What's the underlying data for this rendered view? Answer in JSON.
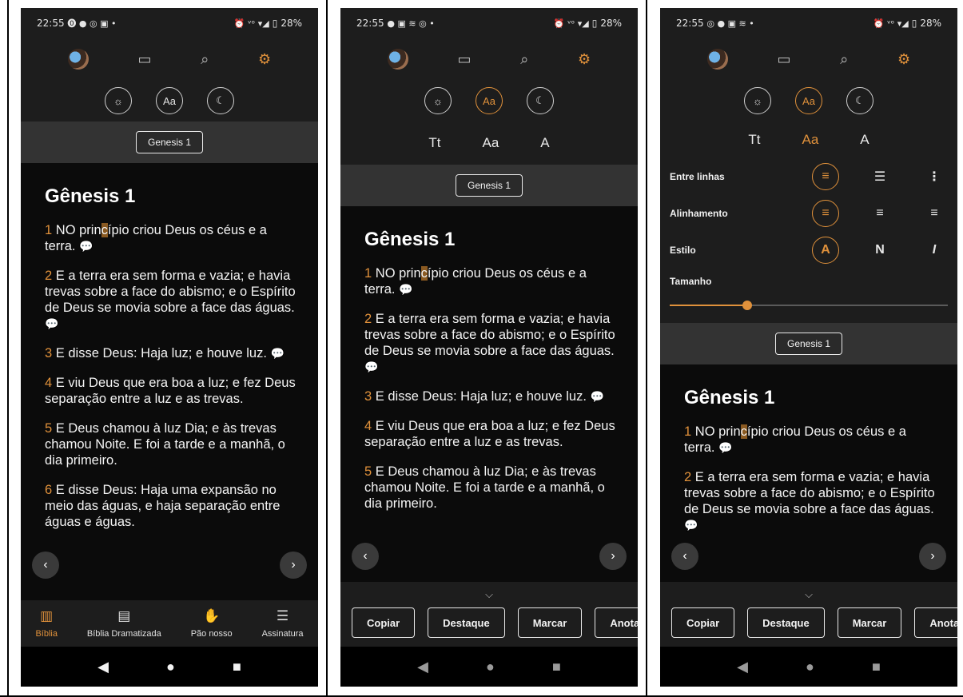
{
  "status": {
    "time": "22:55",
    "battery": "28%",
    "left_icons_1": "⓿ ● ◎ ▣ •",
    "left_icons_2": "● ▣ ≋ ◎ •",
    "left_icons_3": "◎ ● ▣ ≋ •",
    "right_icons": "⏰ ᵛᵒ ▾◢"
  },
  "topnav_icons": [
    "avatar",
    "book-icon",
    "search-icon",
    "gear-icon"
  ],
  "modes": {
    "brightness": "☼",
    "font": "Aa",
    "theme": "☾"
  },
  "typography_tabs": {
    "tt": "Tt",
    "aa": "Aa",
    "a": "A"
  },
  "settings": {
    "line_spacing_label": "Entre linhas",
    "alignment_label": "Alinhamento",
    "style_label": "Estilo",
    "size_label": "Tamanho",
    "style_options": [
      "A",
      "N",
      "I"
    ],
    "size_fraction": 0.28
  },
  "chapter_button": "Genesis 1",
  "reader": {
    "title": "Gênesis 1",
    "verses": [
      {
        "num": "1",
        "pre": "NO prin",
        "hl": "c",
        "post": "ípio criou Deus os céus e a terra."
      },
      {
        "num": "2",
        "text": "E a terra era sem forma e vazia; e havia trevas sobre a face do abismo; e o Espírito de Deus se movia sobre a face das águas."
      },
      {
        "num": "3",
        "text": "E disse Deus: Haja luz; e houve luz."
      },
      {
        "num": "4",
        "text": "E viu Deus que era boa a luz; e fez Deus separação entre a luz e as trevas."
      },
      {
        "num": "5",
        "text": "E Deus chamou à luz Dia; e às trevas chamou Noite. E foi a tarde e a manhã, o dia primeiro."
      },
      {
        "num": "6",
        "text": "E disse Deus: Haja uma expansão no meio das águas, e haja separação entre águas e águas."
      }
    ]
  },
  "actions": [
    "Copiar",
    "Destaque",
    "Marcar",
    "Anotação"
  ],
  "tabs": [
    {
      "label": "Bíblia",
      "icon": "book-icon"
    },
    {
      "label": "Bíblia Dramatizada",
      "icon": "audio-book-icon"
    },
    {
      "label": "Pão nosso",
      "icon": "praying-hands-icon"
    },
    {
      "label": "Assinatura",
      "icon": "checklist-icon"
    }
  ],
  "sysnav": {
    "back": "◀",
    "home": "●",
    "recents": "■"
  },
  "colors": {
    "accent": "#e0913b",
    "panel": "#1d1d1d",
    "background": "#0b0b0b",
    "chapter_bar": "#333333"
  }
}
